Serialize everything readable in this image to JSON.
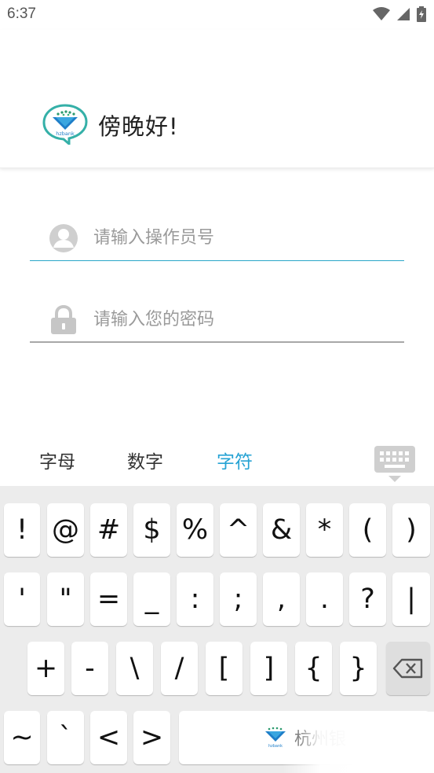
{
  "status_bar": {
    "time": "6:37",
    "icons": [
      "wifi-icon",
      "signal-icon",
      "battery-charging-icon"
    ]
  },
  "header": {
    "logo_icon": "hzbank-logo",
    "logo_text": "hzbank",
    "greeting": "傍晚好!"
  },
  "login": {
    "operator_placeholder": "请输入操作员号",
    "password_placeholder": "请输入您的密码",
    "operator_icon": "user-icon",
    "password_icon": "lock-icon"
  },
  "keyboard": {
    "tabs": [
      {
        "label": "字母",
        "active": false
      },
      {
        "label": "数字",
        "active": false
      },
      {
        "label": "字符",
        "active": true
      }
    ],
    "hide_icon": "keyboard-hide-icon",
    "row1": [
      "!",
      "@",
      "#",
      "$",
      "%",
      "^",
      "&",
      "*",
      "(",
      ")"
    ],
    "row2": [
      "'",
      "\"",
      "=",
      "_",
      ":",
      ";",
      ",",
      ".",
      "?",
      "|"
    ],
    "row3": [
      "+",
      "-",
      "\\",
      "/",
      "[",
      "]",
      "{",
      "}"
    ],
    "row4": [
      "~",
      "`",
      "<",
      ">"
    ],
    "delete_icon": "backspace-icon",
    "space_label": "杭州银",
    "accent_color": "#26a3d4"
  }
}
